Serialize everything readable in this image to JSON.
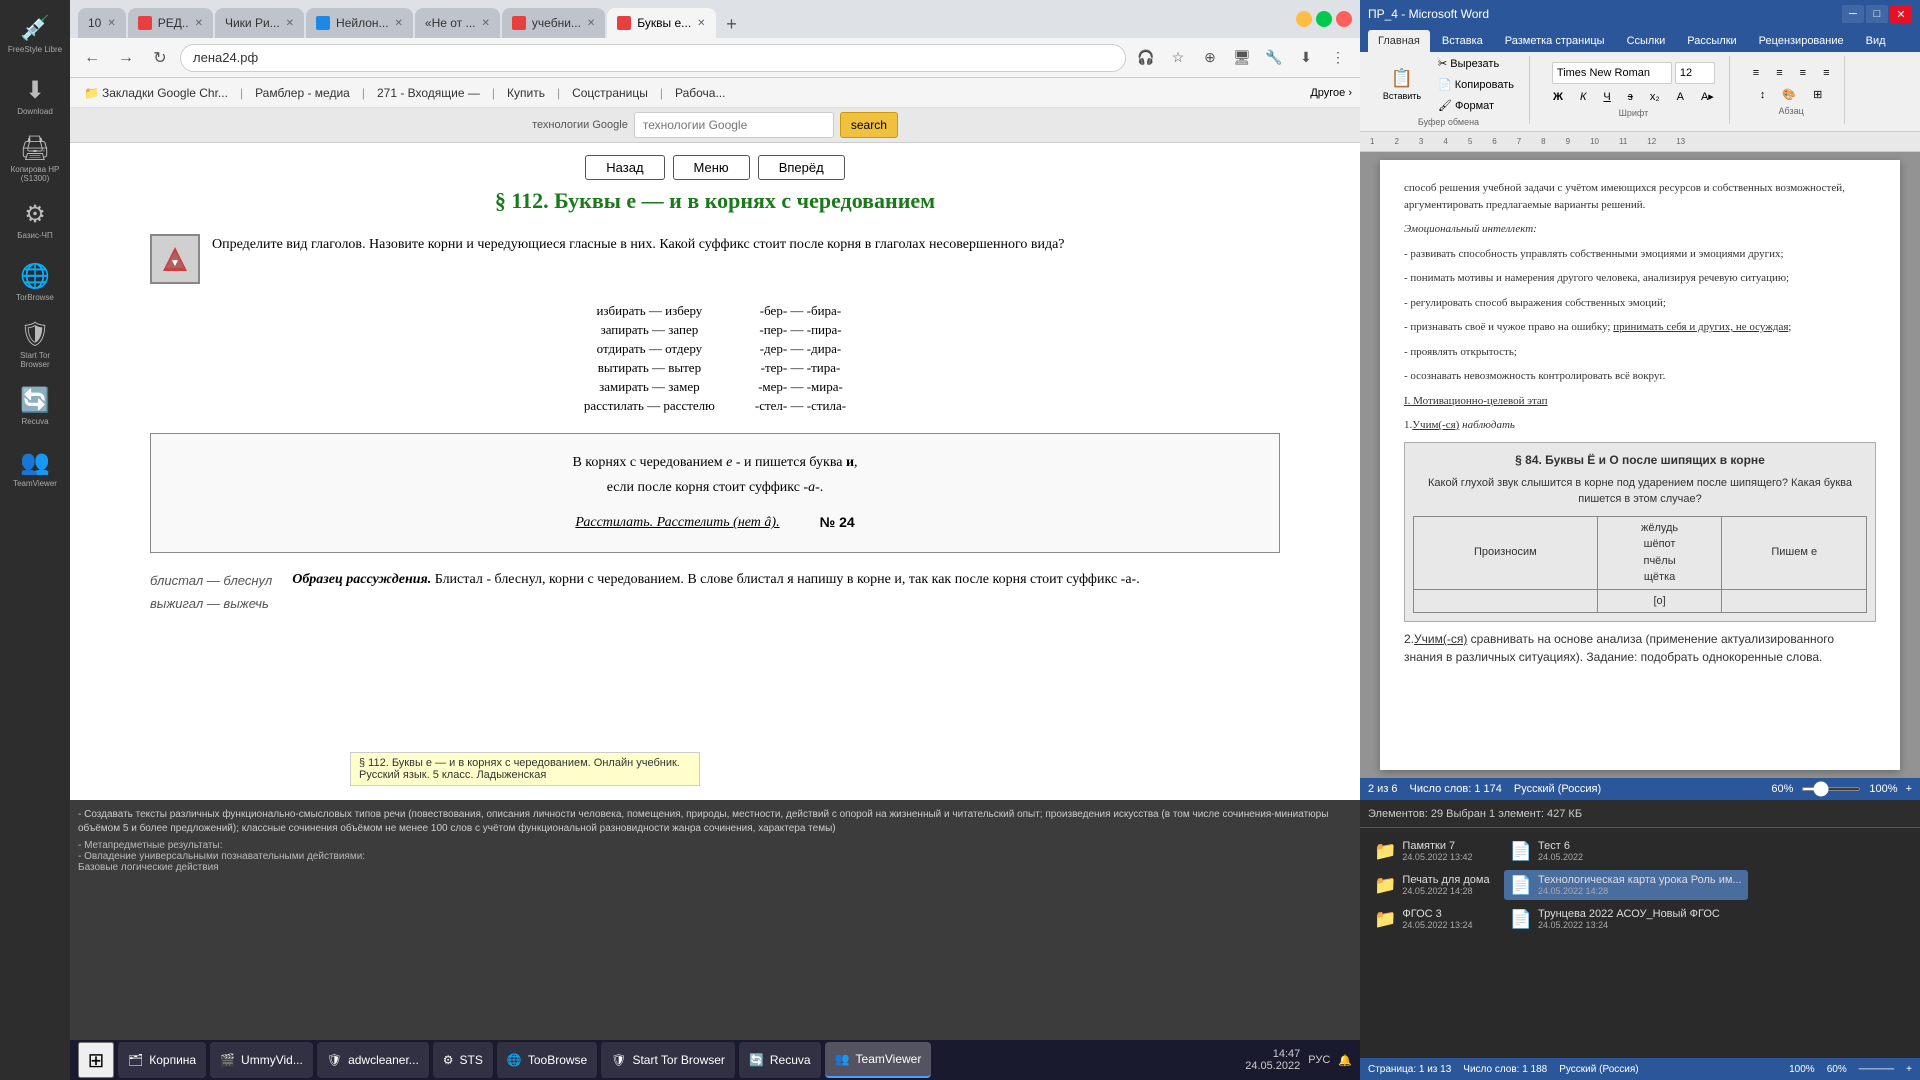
{
  "window_title": "ПР_4 - Microsoft Word",
  "browser": {
    "address": "лена24.рф",
    "full_address": "Буквы е — и в корнях с чередованием. Русский язык 5 класс...",
    "tabs": [
      {
        "label": "10",
        "active": false
      },
      {
        "label": "РЕД...",
        "active": false
      },
      {
        "label": "Чики Ри...",
        "active": false
      },
      {
        "label": "Нейлон...",
        "active": false
      },
      {
        "label": "«Не от ...",
        "active": false
      },
      {
        "label": "учебни...",
        "active": false
      },
      {
        "label": "Буквы е...",
        "active": true
      }
    ],
    "bookmarks": [
      "Закладки Google Chr...",
      "Рамблер - медиа",
      "271 - Входящие —",
      "Купить",
      "Соцстраницы",
      "Рабоча..."
    ],
    "search_placeholder": "технологии Google",
    "search_btn": "search",
    "nav_btns": [
      "←",
      "→",
      "↻"
    ]
  },
  "article": {
    "nav_buttons": [
      "Назад",
      "Меню",
      "Вперёд"
    ],
    "title": "§ 112. Буквы е — и в корнях с чередованием",
    "intro": "Определите вид глаголов. Назовите корни и чередующиеся гласные в них. Какой суффикс стоит после корня в глаголах несовершенного вида?",
    "word_pairs_left": [
      "избирать — изберу",
      "запирать — запер",
      "отдирать — отдеру",
      "вытирать — вытер",
      "замирать — замер",
      "расстилать — расстелю"
    ],
    "word_pairs_right": [
      "-бер- — -бира-",
      "-пер- — -пира-",
      "-дер- — -дира-",
      "-тер- — -тира-",
      "-мер- — -мира-",
      "-стел- — -стила-"
    ],
    "rule_text": "В корнях с чередованием е - и пишется буква и, если после корня стоит суффикс -а-.",
    "rule_example": "Расстилать. Расстелить (нет â).",
    "rule_number": "№ 24",
    "cursive_words": [
      "блистал — блеснул",
      "выжигал — выжечь"
    ],
    "example_text": "Образец рассуждения. Блистал - блеснул, корни с чередованием. В слове блистал я напишу в корне и, так как после корня стоит суффикс -а-.",
    "tooltip": "§ 112. Буквы е — и в корнях с чередованием. Онлайн учебник. Русский язык. 5 класс. Ладыженская"
  },
  "word": {
    "title": "ПР_4 - Microsoft Word",
    "ribbon_tabs": [
      "Главная",
      "Вставка",
      "Разметка страницы",
      "Ссылки",
      "Рассылки",
      "Рецензирование",
      "Вид"
    ],
    "active_tab": "Главная",
    "font_name": "Times New Roman",
    "font_size": "12",
    "content_lines": [
      "способ решения учебной задачи с учётом имеющихся ресурсов и собственных",
      "возможностей, аргументировать предлагаемые варианты решений.",
      "Эмоциональный интеллект:",
      "- развивать способность управлять собственными эмоциями и эмоциями других;",
      "- понимать мотивы и намерения другого человека, анализируя речевую ситуацию;",
      "- регулировать способ выражения собственных эмоций;",
      "- признавать своё и чужое право на ошибку; принимать себя и других, не осуждая;",
      "- проявлять открытость;",
      "- осознавать невозможность контролировать всё вокруг.",
      "I. Мотивационно-целевой этап",
      "1.Учим(-ся) наблюдать"
    ],
    "embedded_section_title": "§ 84. Буквы Ё и О после шипящих в корне",
    "embedded_question": "Какой глухой звук слышится в корне под ударением после шипящего? Какая буква пишется в этом случае?",
    "embedded_table": {
      "headers": [
        "Произносим",
        "жёлудь, шёпот, пчёлы, щётка",
        "Пишем е"
      ],
      "col1": "Произносим",
      "col2": "[о]",
      "col3": "Пишем е"
    },
    "content_after": [
      "2.Учим(-ся) сравнивать на основе анализа (применение актуализированного знания в различных ситуациях). Задание: подобрать однокоренные слова."
    ],
    "status_page": "2 из 6",
    "status_words": "Число слов: 1 174",
    "status_lang": "Русский (Россия)",
    "status_page2": "Страница: 1 из 13",
    "status_words2": "Число слов: 1 188",
    "status_lang2": "Русский (Россия)",
    "zoom": "60%"
  },
  "file_manager": {
    "toolbar_info": "Элементов: 29  Выбран 1 элемент: 427 КБ",
    "folders": [
      {
        "name": "Памятки 7",
        "date": "24.05.2022 13:42"
      },
      {
        "name": "Печать для дома",
        "date": "24.05.2022 14:28"
      },
      {
        "name": "ФГОС 3",
        "date": "24.05.2022 13:24"
      }
    ],
    "files": [
      {
        "name": "Тест 6",
        "date": "24.05.2022"
      },
      {
        "name": "Технологическая карта урока Роль им...",
        "date": "24.05.2022 14:28"
      },
      {
        "name": "Трунцева 2022 АСОУ_Новый ФГОС",
        "date": "24.05.2022 13:24"
      }
    ],
    "description": "- Создавать тексты различных функционально-смысловых типов речи (повествования, описания личности человека, помещения, природы, местности, действий с опорой на жизненный и читательский опыт; произведения искусства (в том числе сочинения-миниатюры объёмом 5 и более предложений); классные сочинения объёмом не менее 100 слов с учётом функциональной разновидности жанра сочинения, характера темы)"
  },
  "taskbar": {
    "time": "14:47",
    "date": "24.05.2022",
    "apps": [
      "Корпина",
      "UmmyVid...",
      "adwcleaner...",
      "STS",
      "TooBrowse",
      "Start Tor Browser",
      "Recuva",
      "TeamViewer"
    ]
  },
  "sidebar_icons": [
    {
      "name": "FreeStyle Libre",
      "emoji": "💉"
    },
    {
      "name": "Download",
      "emoji": "⬇"
    },
    {
      "name": "Копирова HP (S1300)",
      "emoji": "🖨"
    },
    {
      "name": "Базис-ЧП",
      "emoji": "⚙"
    },
    {
      "name": "TorBrowse",
      "emoji": "🌐"
    },
    {
      "name": "Start Tor Browser",
      "emoji": "🛡"
    },
    {
      "name": "Recuva",
      "emoji": "🔄"
    },
    {
      "name": "TeamViewer",
      "emoji": "👥"
    }
  ]
}
